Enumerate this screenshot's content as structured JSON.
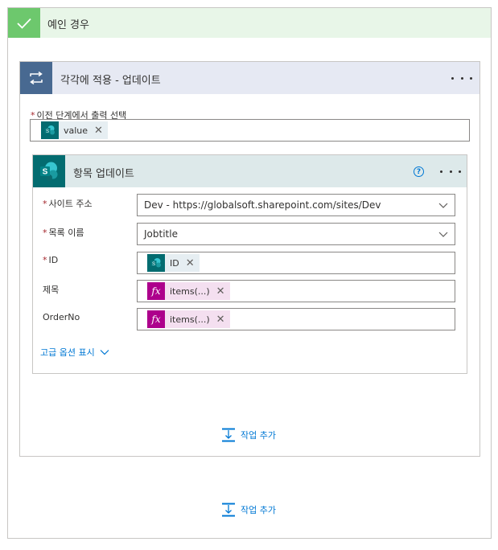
{
  "if_yes": {
    "title": "예인 경우"
  },
  "foreach": {
    "title": "각각에 적용 - 업데이트",
    "output_label": "이전 단계에서 출력 선택",
    "output_token": "value"
  },
  "update_item": {
    "title": "항목 업데이트",
    "site_label": "사이트 주소",
    "site_value": "Dev - https://globalsoft.sharepoint.com/sites/Dev",
    "list_label": "목록 이름",
    "list_value": "Jobtitle",
    "id_label": "ID",
    "id_token": "ID",
    "title_label": "제목",
    "title_token": "items(...)",
    "orderno_label": "OrderNo",
    "orderno_token": "items(...)",
    "advanced_label": "고급 옵션 표시"
  },
  "required_marker": "*",
  "add_action_inner": "작업 추가",
  "add_action_outer": "작업 추가",
  "colors": {
    "yes_green": "#6dc86d",
    "foreach_blue": "#486991",
    "sharepoint_teal": "#036c70",
    "expression_magenta": "#ad008c",
    "link_blue": "#0078d4"
  }
}
